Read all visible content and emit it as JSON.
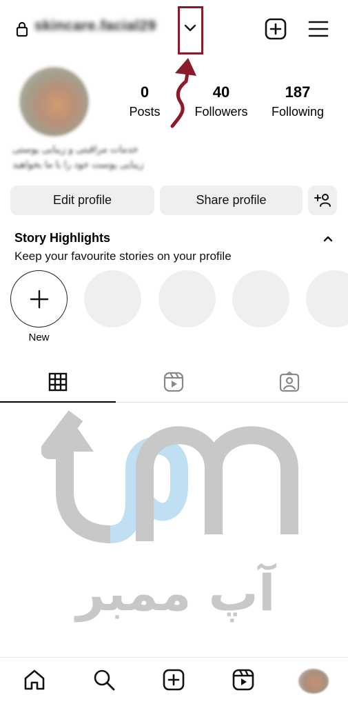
{
  "header": {
    "username": "skincare.facial29",
    "dropdown_icon": "chevron-down-icon",
    "new_post_icon": "plus-square-icon",
    "menu_icon": "hamburger-icon",
    "annotation_color": "#8b1a2b"
  },
  "profile": {
    "stats": [
      {
        "value": "0",
        "label": "Posts"
      },
      {
        "value": "40",
        "label": "Followers"
      },
      {
        "value": "187",
        "label": "Following"
      }
    ],
    "bio_lines": [
      "خدمات مراقبتی و زیبایی پوستی",
      "زیبایی پوست خود را با ما بخواهید"
    ]
  },
  "actions": {
    "edit_label": "Edit profile",
    "share_label": "Share profile",
    "add_person_icon": "add-person-icon"
  },
  "highlights": {
    "title": "Story Highlights",
    "subtitle": "Keep your favourite stories on your profile",
    "new_label": "New"
  },
  "tabs": [
    "grid-icon",
    "reels-icon",
    "tagged-icon"
  ],
  "watermark": {
    "text": "آپ ممبر",
    "colors": {
      "gray": "#c8c8c8",
      "blue": "#bfe0f3"
    }
  },
  "bottom_nav": [
    "home-icon",
    "search-icon",
    "create-icon",
    "reels-icon",
    "profile-avatar"
  ]
}
